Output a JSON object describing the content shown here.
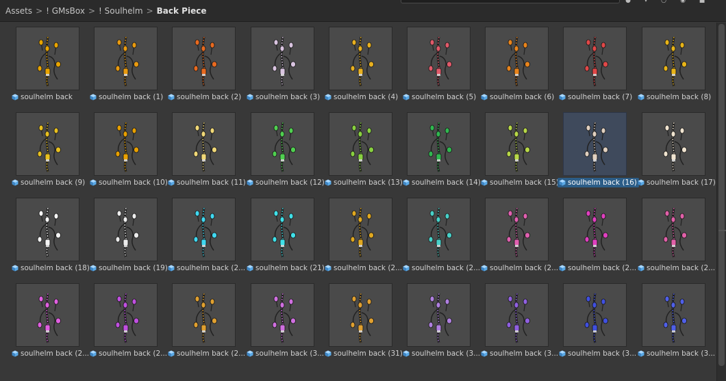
{
  "breadcrumb": {
    "items": [
      "Assets",
      "! GMsBox",
      "! Soulhelm",
      "Back Piece"
    ],
    "separator": ">"
  },
  "toolbar": {
    "icons": [
      "search-icon",
      "filter-icon",
      "star-icon",
      "eye-icon",
      "count-icon"
    ]
  },
  "assets": [
    {
      "name": "soulhelm back",
      "color": "#e8a400"
    },
    {
      "name": "soulhelm back (1)",
      "color": "#e89a10"
    },
    {
      "name": "soulhelm back (2)",
      "color": "#e86a20"
    },
    {
      "name": "soulhelm back (3)",
      "color": "#d9c4e0"
    },
    {
      "name": "soulhelm back (4)",
      "color": "#e8b020"
    },
    {
      "name": "soulhelm back (5)",
      "color": "#e05a6a"
    },
    {
      "name": "soulhelm back (6)",
      "color": "#e8841c"
    },
    {
      "name": "soulhelm back (7)",
      "color": "#e04848"
    },
    {
      "name": "soulhelm back (8)",
      "color": "#e8b418"
    },
    {
      "name": "soulhelm back (9)",
      "color": "#e8c020"
    },
    {
      "name": "soulhelm back (10)",
      "color": "#e8a000"
    },
    {
      "name": "soulhelm back (11)",
      "color": "#f0d878"
    },
    {
      "name": "soulhelm back (12)",
      "color": "#50d050"
    },
    {
      "name": "soulhelm back (13)",
      "color": "#88d040"
    },
    {
      "name": "soulhelm back (14)",
      "color": "#30b850"
    },
    {
      "name": "soulhelm back (15)",
      "color": "#b8d848"
    },
    {
      "name": "soulhelm back (16)",
      "color": "#e0d0c0"
    },
    {
      "name": "soulhelm back (17)",
      "color": "#f0e4d0"
    },
    {
      "name": "soulhelm back (18)",
      "color": "#f4f4f4"
    },
    {
      "name": "soulhelm back (19)",
      "color": "#ececec"
    },
    {
      "name": "soulhelm back (2...",
      "color": "#40d8f0"
    },
    {
      "name": "soulhelm back (21)",
      "color": "#40e0e8"
    },
    {
      "name": "soulhelm back (2...",
      "color": "#e0a820"
    },
    {
      "name": "soulhelm back (2...",
      "color": "#48d0c8"
    },
    {
      "name": "soulhelm back (2...",
      "color": "#e060b0"
    },
    {
      "name": "soulhelm back (2...",
      "color": "#e040c0"
    },
    {
      "name": "soulhelm back (2...",
      "color": "#e060a8"
    },
    {
      "name": "soulhelm back (2...",
      "color": "#e060e0"
    },
    {
      "name": "soulhelm back (2...",
      "color": "#c050e0"
    },
    {
      "name": "soulhelm back (2...",
      "color": "#e0a030"
    },
    {
      "name": "soulhelm back (3...",
      "color": "#d070e0"
    },
    {
      "name": "soulhelm back (31)",
      "color": "#e0a030"
    },
    {
      "name": "soulhelm back (3...",
      "color": "#b080e0"
    },
    {
      "name": "soulhelm back (3...",
      "color": "#9060e0"
    },
    {
      "name": "soulhelm back (3...",
      "color": "#4050e0"
    },
    {
      "name": "soulhelm back (3...",
      "color": "#5060e8"
    }
  ],
  "selected_index": 16
}
